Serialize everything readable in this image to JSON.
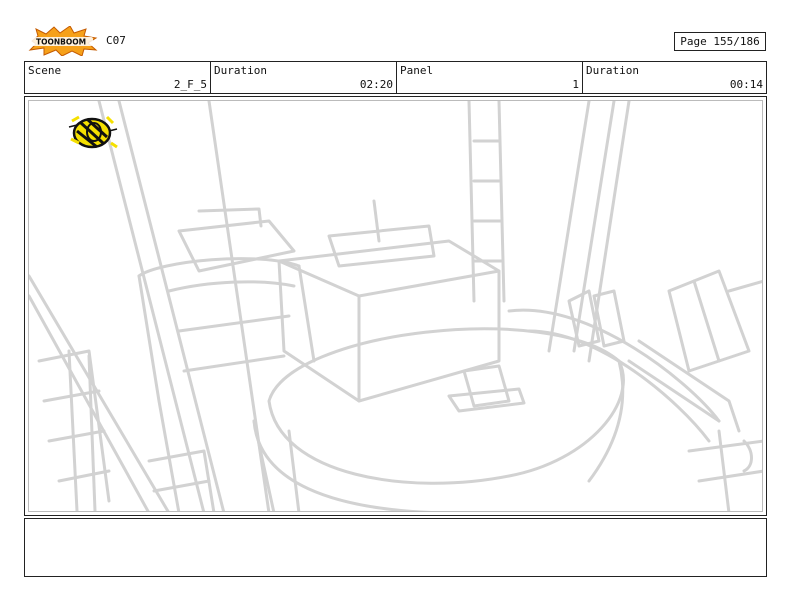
{
  "header": {
    "logo_text": "TOONBOOM",
    "sheet_code": "C07",
    "page_label": "Page 155/186"
  },
  "info": {
    "scene_label": "Scene",
    "scene_value": "2_F_5",
    "scene_duration_label": "Duration",
    "scene_duration_value": "02:20",
    "panel_label": "Panel",
    "panel_value": "1",
    "panel_duration_label": "Duration",
    "panel_duration_value": "00:14"
  },
  "panel": {
    "sketch_line_color": "#d2d2d2",
    "bee_yellow": "#f5e000"
  },
  "notes": {
    "text": ""
  }
}
